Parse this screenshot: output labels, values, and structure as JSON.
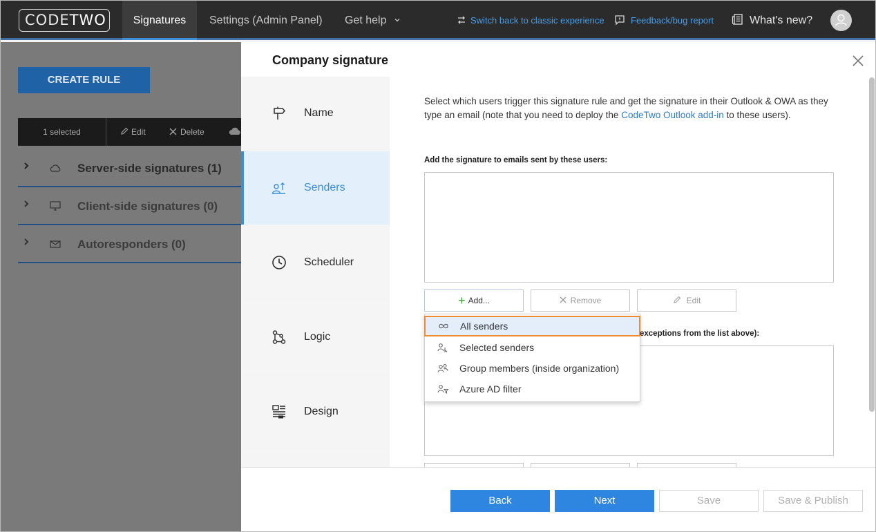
{
  "header": {
    "logo_text_a": "CODE",
    "logo_text_b": "TWO",
    "nav": [
      "Signatures",
      "Settings (Admin Panel)",
      "Get help"
    ],
    "switch_link": "Switch back to classic experience",
    "feedback_link": "Feedback/bug report",
    "whats_new": "What's new?"
  },
  "left": {
    "create_rule": "CREATE RULE",
    "toolbar": {
      "selected": "1 selected",
      "edit": "Edit",
      "delete": "Delete"
    },
    "groups": [
      "Server-side signatures (1)",
      "Client-side signatures (0)",
      "Autoresponders (0)"
    ]
  },
  "modal": {
    "title": "Company signature",
    "steps": [
      "Name",
      "Senders",
      "Scheduler",
      "Logic",
      "Design"
    ],
    "intro_a": "Select which users trigger this signature rule and get the signature in their Outlook & OWA as they type an email (note that you need to deploy the ",
    "intro_link": "CodeTwo Outlook add-in",
    "intro_b": " to these users).",
    "section1": "Add the signature to emails sent by these users:",
    "section2": "exceptions from the list above):",
    "add": "Add...",
    "remove": "Remove",
    "edit": "Edit",
    "dropdown": [
      "All senders",
      "Selected senders",
      "Group members (inside organization)",
      "Azure AD filter"
    ],
    "footer": {
      "back": "Back",
      "next": "Next",
      "save": "Save",
      "save_publish": "Save & Publish"
    }
  },
  "colors": {
    "accent": "#2f86e0",
    "highlight_border": "#f08a2c",
    "topbar": "#2b2b2b"
  }
}
